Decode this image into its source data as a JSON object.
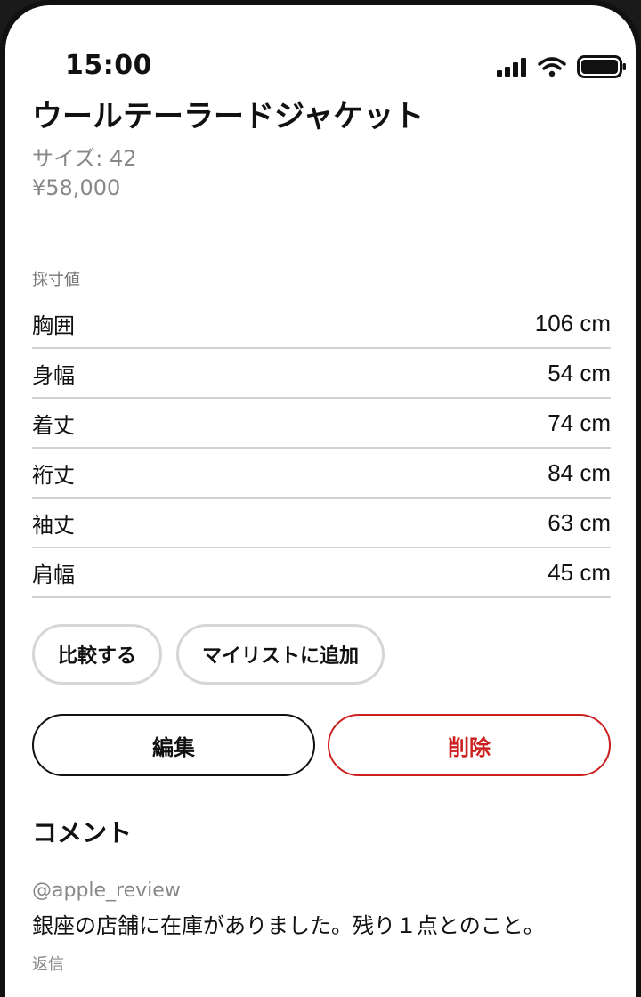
{
  "status_bar": {
    "time": "15:00",
    "icons": [
      "signal-icon",
      "wifi-icon",
      "battery-icon"
    ]
  },
  "product": {
    "title": "ウールテーラードジャケット",
    "size": "サイズ: 42",
    "price": "¥58,000"
  },
  "measurements": {
    "label": "採寸値",
    "rows": [
      {
        "name": "胸囲",
        "value": "106 cm"
      },
      {
        "name": "身幅",
        "value": "54 cm"
      },
      {
        "name": "着丈",
        "value": "74 cm"
      },
      {
        "name": "裄丈",
        "value": "84 cm"
      },
      {
        "name": "袖丈",
        "value": "63 cm"
      },
      {
        "name": "肩幅",
        "value": "45 cm"
      }
    ]
  },
  "chips": {
    "compare": "比較する",
    "add_to_list": "マイリストに追加"
  },
  "actions": {
    "edit": "編集",
    "delete": "削除"
  },
  "comments": {
    "heading": "コメント",
    "items": [
      {
        "user": "@apple_review",
        "text": "銀座の店舗に在庫がありました。残り１点とのこと。",
        "reply_label": "返信"
      }
    ]
  },
  "colors": {
    "danger": "#cc1f1f",
    "muted_text": "#888888",
    "divider": "#d2d2d2",
    "chip_border": "#d6d6d6"
  }
}
